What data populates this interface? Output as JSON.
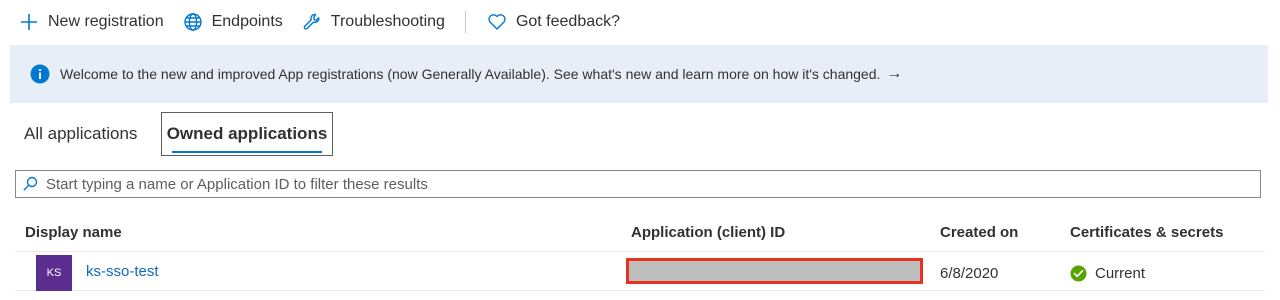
{
  "toolbar": {
    "new_registration": "New registration",
    "endpoints": "Endpoints",
    "troubleshooting": "Troubleshooting",
    "feedback": "Got feedback?"
  },
  "banner": {
    "text": "Welcome to the new and improved App registrations (now Generally Available). See what's new and learn more on how it's changed.",
    "arrow": "→"
  },
  "tabs": [
    {
      "label": "All applications"
    },
    {
      "label": "Owned applications"
    }
  ],
  "search": {
    "placeholder": "Start typing a name or Application ID to filter these results"
  },
  "table": {
    "columns": [
      "Display name",
      "Application (client) ID",
      "Created on",
      "Certificates & secrets"
    ],
    "rows": [
      {
        "initials": "KS",
        "name": "ks-sso-test",
        "created_on": "6/8/2020",
        "certificates": "Current"
      }
    ]
  },
  "colors": {
    "accent": "#0078d4",
    "avatar": "#5c2d91",
    "banner_bg": "#e8eef7",
    "status_ok": "#57a300",
    "redaction_border": "#e8311f"
  },
  "icons": {
    "new": "plus-icon",
    "endpoints": "globe-icon",
    "troubleshooting": "wrench-icon",
    "feedback": "heart-icon",
    "info": "info-icon",
    "search": "search-icon",
    "status": "check-circle-icon"
  }
}
